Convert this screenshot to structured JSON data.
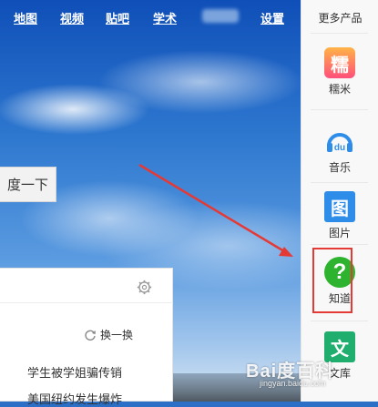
{
  "topnav": {
    "links": [
      "地图",
      "视频",
      "贴吧",
      "学术",
      "设置"
    ]
  },
  "search": {
    "button_label": "度一下"
  },
  "hot_panel": {
    "refresh_label": "换一换",
    "items": [
      "学生被学姐骗传销",
      "美国纽约发生爆炸"
    ]
  },
  "sidebar": {
    "title": "更多产品",
    "items": [
      {
        "label": "糯米",
        "icon": "nuomi-icon",
        "glyph": "糯",
        "color": "#ff4f7b"
      },
      {
        "label": "音乐",
        "icon": "music-icon",
        "glyph": "du",
        "color": "#2e8de8"
      },
      {
        "label": "图片",
        "icon": "image-icon",
        "glyph": "图",
        "color": "#2e8de8"
      },
      {
        "label": "知道",
        "icon": "zhidao-icon",
        "glyph": "?",
        "color": "#2db32d"
      },
      {
        "label": "文库",
        "icon": "wenku-icon",
        "glyph": "文",
        "color": "#1fae6e"
      }
    ]
  },
  "annotation": {
    "arrow_color": "#e53935",
    "box_color": "#e53935"
  },
  "watermark": {
    "main": "Bai度百科",
    "sub": "jingyan.baidu.com"
  }
}
